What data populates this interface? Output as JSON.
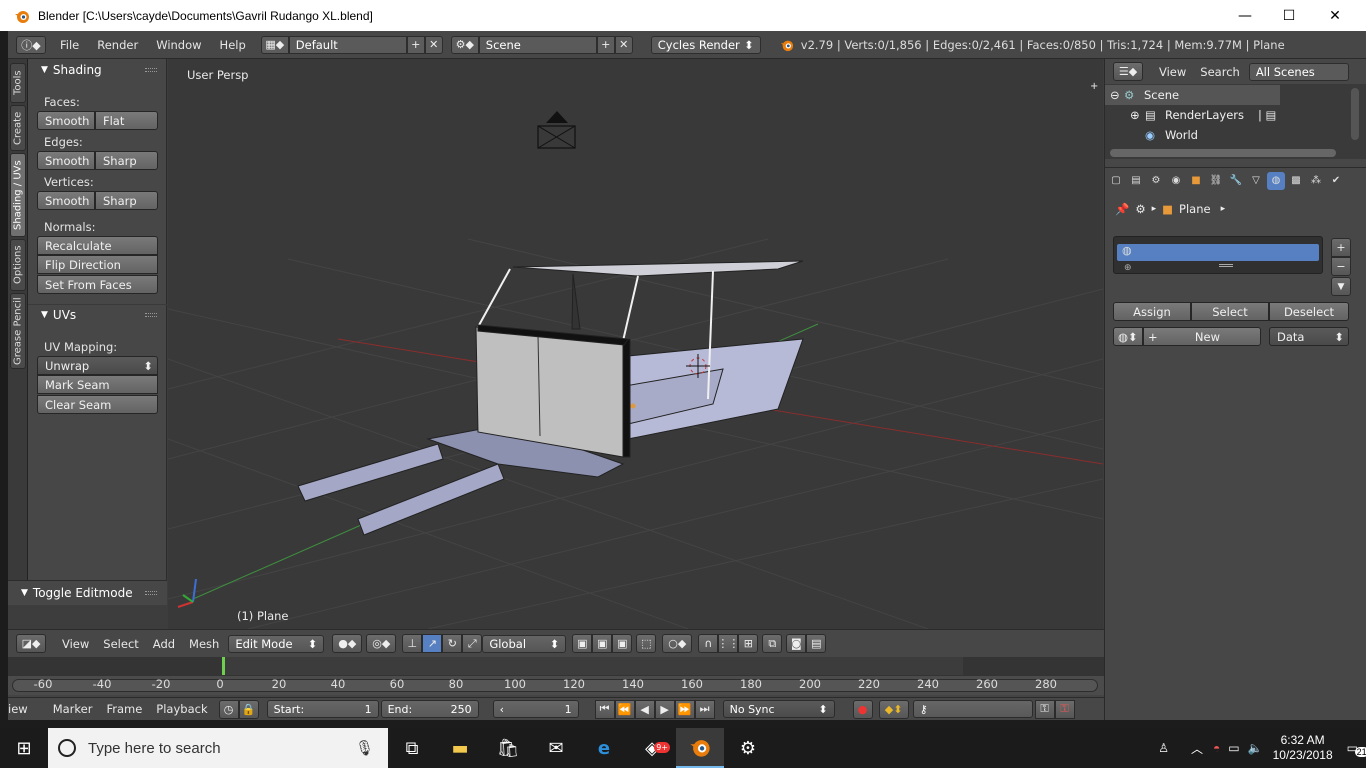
{
  "window": {
    "title": "Blender [C:\\Users\\cayde\\Documents\\Gavril Rudango XL.blend]",
    "minimize": "—",
    "maximize": "☐",
    "close": "✕"
  },
  "menu": {
    "file": "File",
    "render": "Render",
    "window": "Window",
    "help": "Help",
    "layout": "Default",
    "scene": "Scene",
    "engine": "Cycles Render"
  },
  "stats": "v2.79 | Verts:0/1,856 | Edges:0/2,461 | Faces:0/850 | Tris:1,724 | Mem:9.77M | Plane",
  "tabs": [
    "Tools",
    "Create",
    "Shading / UVs",
    "Options",
    "Grease Pencil"
  ],
  "shading": {
    "title": "Shading",
    "faces_label": "Faces:",
    "edges_label": "Edges:",
    "vertices_label": "Vertices:",
    "smooth": "Smooth",
    "flat": "Flat",
    "sharp": "Sharp",
    "normals_label": "Normals:",
    "recalculate": "Recalculate",
    "flip": "Flip Direction",
    "set_from_faces": "Set From Faces"
  },
  "uvs": {
    "title": "UVs",
    "mapping_label": "UV Mapping:",
    "unwrap": "Unwrap",
    "mark_seam": "Mark Seam",
    "clear_seam": "Clear Seam"
  },
  "toggle_editmode": "Toggle Editmode",
  "viewport": {
    "persp": "User Persp",
    "object_label": "(1) Plane"
  },
  "view_header": {
    "view": "View",
    "select": "Select",
    "add": "Add",
    "mesh": "Mesh",
    "mode": "Edit Mode",
    "orientation": "Global"
  },
  "timeline": {
    "ticks": [
      "-60",
      "-40",
      "-20",
      "0",
      "20",
      "40",
      "60",
      "80",
      "100",
      "120",
      "140",
      "160",
      "180",
      "200",
      "220",
      "240",
      "260",
      "280"
    ],
    "view": "iew",
    "marker": "Marker",
    "frame": "Frame",
    "playback": "Playback",
    "start_label": "Start:",
    "start": "1",
    "end_label": "End:",
    "end": "250",
    "current": "1",
    "sync": "No Sync"
  },
  "outliner": {
    "view": "View",
    "search": "Search",
    "filter": "All Scenes",
    "scene": "Scene",
    "renderlayers": "RenderLayers",
    "world": "World"
  },
  "properties": {
    "object": "Plane",
    "assign": "Assign",
    "select": "Select",
    "deselect": "Deselect",
    "new": "New",
    "data": "Data"
  },
  "taskbar": {
    "search_placeholder": "Type here to search",
    "time": "6:32 AM",
    "date": "10/23/2018",
    "notifications": "21",
    "badge": "9+"
  }
}
